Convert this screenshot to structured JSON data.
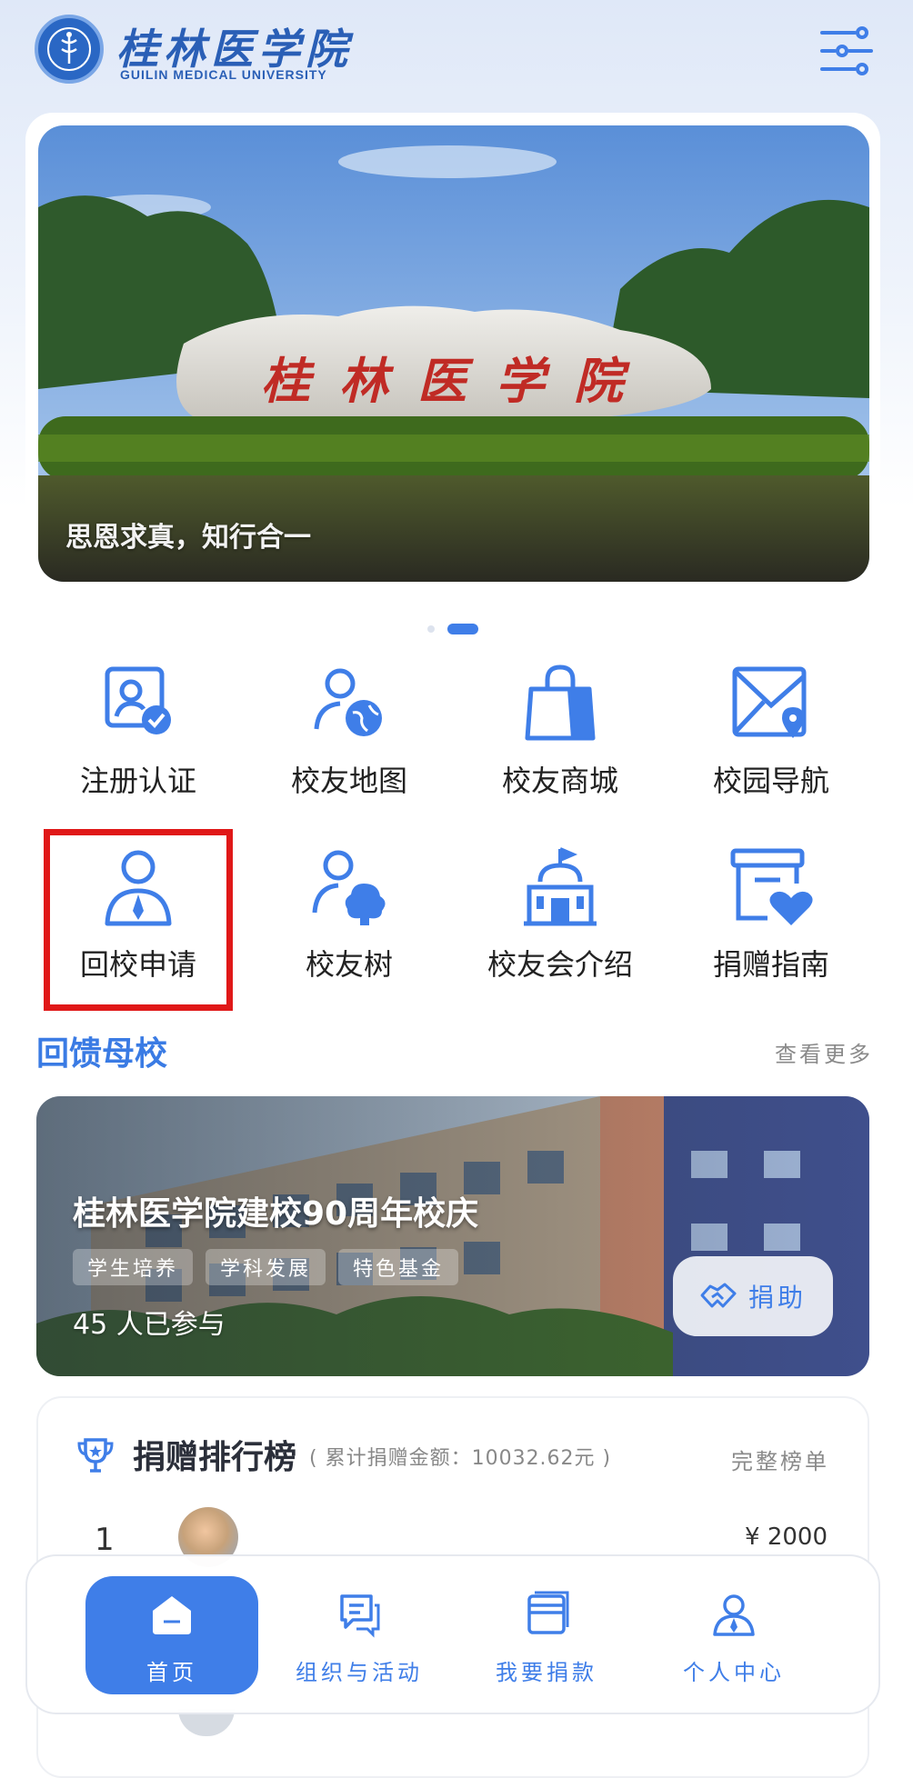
{
  "header": {
    "title_cn": "桂林医学院",
    "title_en": "GUILIN MEDICAL UNIVERSITY",
    "logo_icon": "university-seal-icon",
    "menu_icon": "filter-menu-icon"
  },
  "banner": {
    "sign_text": "桂林医学院",
    "caption": "思恩求真，知行合一",
    "slide_count": 2,
    "active_slide": 2
  },
  "grid": [
    {
      "label": "注册认证",
      "icon": "verified-user-icon"
    },
    {
      "label": "校友地图",
      "icon": "user-globe-icon"
    },
    {
      "label": "校友商城",
      "icon": "shopping-bag-icon"
    },
    {
      "label": "校园导航",
      "icon": "map-pin-icon"
    },
    {
      "label": "回校申请",
      "icon": "person-tie-icon"
    },
    {
      "label": "校友树",
      "icon": "user-tree-icon"
    },
    {
      "label": "校友会介绍",
      "icon": "school-building-icon"
    },
    {
      "label": "捐赠指南",
      "icon": "box-heart-icon"
    }
  ],
  "section": {
    "title": "回馈母校",
    "more": "查看更多"
  },
  "promo": {
    "title": "桂林医学院建校90周年校庆",
    "tags": [
      "学生培养",
      "学科发展",
      "特色基金"
    ],
    "participants": "45 人已参与",
    "donate_label": "捐助"
  },
  "ranking": {
    "title": "捐赠排行榜",
    "subtitle": "( 累计捐赠金额：10032.62元 )",
    "full_list": "完整榜单",
    "rows": [
      {
        "rank": "1",
        "amount": "¥ 2000"
      }
    ]
  },
  "tabbar": [
    {
      "label": "首页",
      "icon": "home-icon",
      "active": true
    },
    {
      "label": "组织与活动",
      "icon": "chat-bubbles-icon",
      "active": false
    },
    {
      "label": "我要捐款",
      "icon": "wallet-card-icon",
      "active": false
    },
    {
      "label": "个人中心",
      "icon": "profile-icon",
      "active": false
    }
  ],
  "colors": {
    "accent": "#3f7ee8",
    "brand": "#2a5fb6",
    "highlight": "#e01818"
  }
}
